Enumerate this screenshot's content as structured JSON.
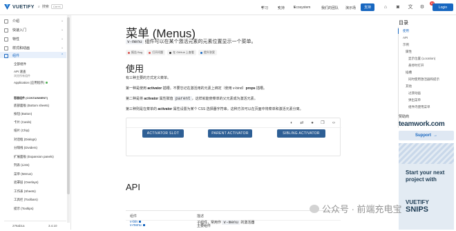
{
  "brand": {
    "name": "VUETIFY"
  },
  "topbar": {
    "search_label": "搜索",
    "search_kbd": "Ctrl+K",
    "nav": [
      "学习",
      "支持",
      "Ecosystem",
      "我们的团队",
      "演示场"
    ],
    "support_button": "支持",
    "login_button": "Login",
    "badge_count": "10"
  },
  "sidebar": {
    "items": [
      {
        "label": "介绍",
        "icon": "book-icon"
      },
      {
        "label": "快速入门",
        "icon": "rocket-icon"
      },
      {
        "label": "特性",
        "icon": "star-icon"
      },
      {
        "label": "样式和动画",
        "icon": "palette-icon"
      },
      {
        "label": "组件",
        "icon": "components-icon"
      }
    ],
    "sub": {
      "all": "全部组件",
      "api": "API 速查",
      "api_sub": "浏览所有组件",
      "app": "Application (应用程序)"
    },
    "section": "容器组件 (CONTAINMENT)",
    "components": [
      "底部面板 (Bottom sheets)",
      "按钮 (Button)",
      "卡片 (Cards)",
      "纸片 (Chip)",
      "对话框 (Dialogs)",
      "分隔线 (Dividers)",
      "扩展面板 (Expansion panels)",
      "列表 (Lists)",
      "菜单 (Menus)",
      "遮罩层 (Overlays)",
      "工作表 (Sheets)",
      "工具栏 (Toolbars)",
      "提示 (Tooltips)"
    ],
    "footer_version": "276ab1a",
    "footer_version2": "3.4.10"
  },
  "main": {
    "title": "菜单 (Menus)",
    "lead_code": "v-menu",
    "lead_text": "组件可以在某个激活元素的元素位置显示一个菜单。",
    "chips": [
      "报告 Bug",
      "打开问题",
      "在 GitHub 上查看",
      "提升答案"
    ],
    "usage_heading": "使用",
    "p0": "有三种主要的方式定义菜单。",
    "p1_a": "第一种是使用 ",
    "p1_b": "activator",
    "p1_c": " 插槽。不要忘记在激活用的元素上绑定（使用 v-bind）",
    "p1_d": "props",
    "p1_e": " 插槽。",
    "p2_a": "第二种是将 ",
    "p2_b": "activator",
    "p2_c": " 属性赋值 ",
    "p2_d": "parent",
    "p2_e": "，这样就能使菜单的父元素成为激活元素。",
    "p3_a": "第三种则是在菜单的 ",
    "p3_b": "activator",
    "p3_c": " 属性设置为某个 CSS 选择器字符串。这种方法可以在页面中将菜单和激活元素分离。",
    "buttons": [
      "ACTIVATOR SLOT",
      "PARENT ACTIVATOR",
      "SIBLING ACTIVATOR"
    ],
    "api_heading": "API",
    "table_headers": [
      "组件",
      "描述"
    ],
    "rows": [
      {
        "name": "v-menu",
        "desc": "主要组件"
      },
      {
        "name": "v-btn",
        "desc_a": "子组件，常用作 ",
        "desc_code": "v-menu",
        "desc_b": " 的激活器"
      }
    ]
  },
  "toc": {
    "title": "目录",
    "items": [
      {
        "label": "使用",
        "level": 0,
        "active": true
      },
      {
        "label": "API",
        "level": 0
      },
      {
        "label": "示例",
        "level": 0
      },
      {
        "label": "属性",
        "level": 1
      },
      {
        "label": "显示位置 (Location)",
        "level": 2
      },
      {
        "label": "悬停时打开",
        "level": 2
      },
      {
        "label": "插槽",
        "level": 1
      },
      {
        "label": "同时使用激活器和提示",
        "level": 2
      },
      {
        "label": "其他",
        "level": 1
      },
      {
        "label": "过渡动画",
        "level": 2
      },
      {
        "label": "弹出菜单",
        "level": 2
      },
      {
        "label": "组件内使用菜单",
        "level": 2
      }
    ],
    "sponsor": "赞助商",
    "sponsor_name": "teamwork.com",
    "support_label": "Support",
    "ad_text": "Start your next project with",
    "ad_logo_line1": "VUETIFY",
    "ad_logo_line2": "SNIPS"
  },
  "watermark": "公众号 · 前端充电宝",
  "colors": {
    "accent": "#1867c0",
    "button": "#2e5f95"
  }
}
